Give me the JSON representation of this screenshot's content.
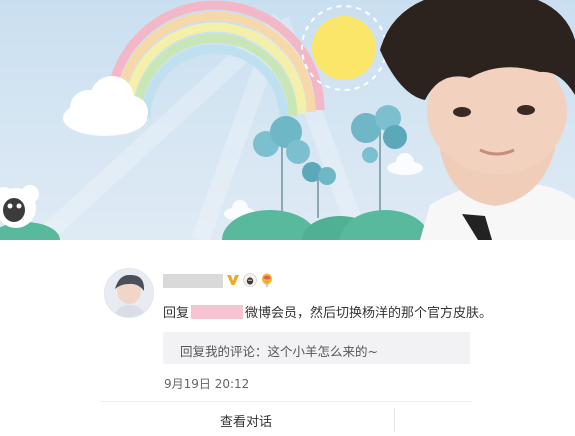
{
  "banner": {
    "theme": "official-skin-yangyang",
    "colors": {
      "sky": "#cfe2f1",
      "sun": "#fbe66a",
      "tree": "#6fb6c6",
      "hill": "#58b99c"
    }
  },
  "comment": {
    "reply_prefix": "回复",
    "reply_suffix": "微博会员，然后切换杨洋的那个官方皮肤。",
    "quote_text": "回复我的评论：这个小羊怎么来的~",
    "timestamp": "9月19日 20:12",
    "badges": [
      "vip-v-icon",
      "sheep-icon",
      "balloon-icon"
    ]
  },
  "actions": {
    "view_dialog_label": "查看对话"
  }
}
